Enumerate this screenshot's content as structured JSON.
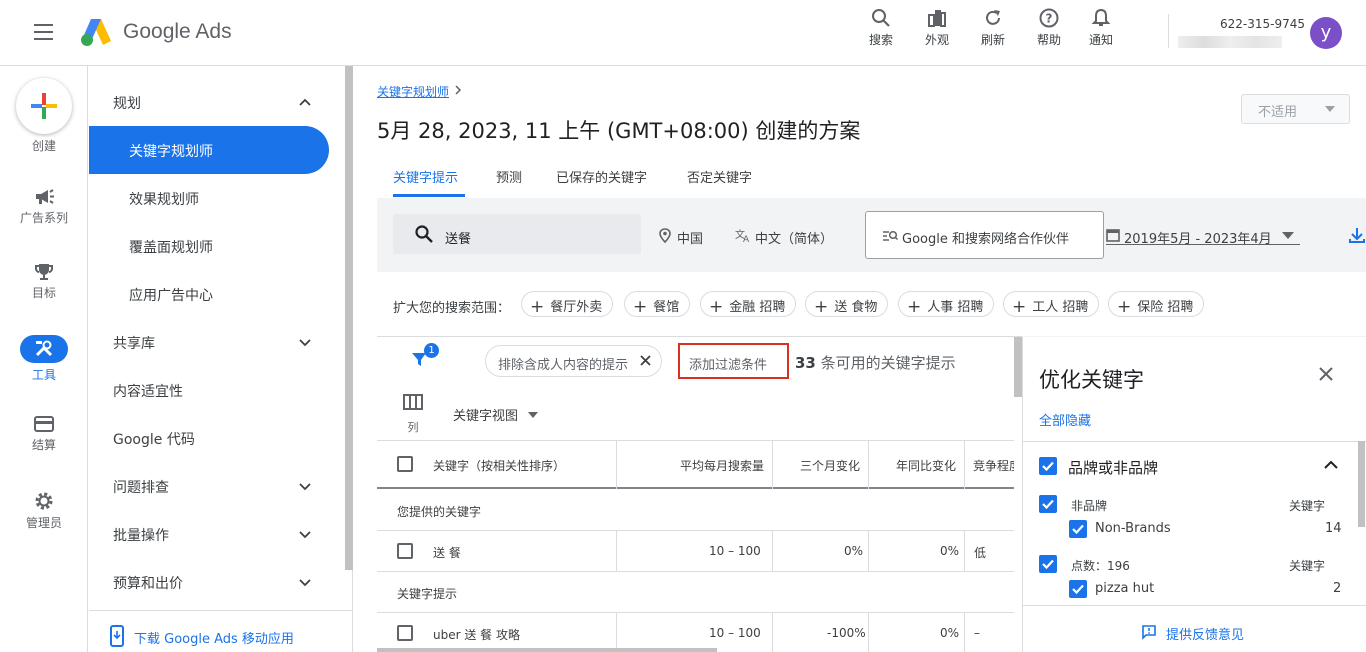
{
  "header": {
    "app_name": "Google Ads",
    "tools": [
      {
        "label": "搜索",
        "icon": "search-icon"
      },
      {
        "label": "外观",
        "icon": "appearance-icon"
      },
      {
        "label": "刷新",
        "icon": "refresh-icon"
      },
      {
        "label": "帮助",
        "icon": "help-icon"
      },
      {
        "label": "通知",
        "icon": "bell-icon"
      }
    ],
    "account_id": "622-315-9745",
    "avatar_letter": "y"
  },
  "rail": {
    "items": [
      {
        "label": "创建",
        "icon": "plus-icon"
      },
      {
        "label": "广告系列",
        "icon": "megaphone-icon"
      },
      {
        "label": "目标",
        "icon": "trophy-icon"
      },
      {
        "label": "工具",
        "icon": "tools-icon",
        "active": true
      },
      {
        "label": "结算",
        "icon": "credit-card-icon"
      },
      {
        "label": "管理员",
        "icon": "gear-icon"
      }
    ]
  },
  "nav": {
    "planning_header": "规划",
    "planning_items": [
      "关键字规划师",
      "效果规划师",
      "覆盖面规划师",
      "应用广告中心"
    ],
    "sections": [
      "共享库",
      "内容适宜性",
      "Google 代码",
      "问题排查",
      "批量操作",
      "预算和出价"
    ],
    "download_app": "下载 Google Ads 移动应用"
  },
  "main": {
    "breadcrumb": "关键字规划师",
    "title": "5月 28, 2023, 11 上午 (GMT+08:00) 创建的方案",
    "na_select": "不适用",
    "tabs": [
      "关键字提示",
      "预测",
      "已保存的关键字",
      "否定关键字"
    ],
    "search_value": "送餐",
    "location": "中国",
    "language": "中文（简体）",
    "network": "Google 和搜索网络合作伙伴",
    "date_range": "2019年5月 - 2023年4月",
    "expand_label": "扩大您的搜索范围：",
    "expand_chips": [
      "餐厅外卖",
      "餐馆",
      "金融 招聘",
      "送 食物",
      "人事 招聘",
      "工人 招聘",
      "保险 招聘"
    ],
    "filter_badge": "1",
    "exclude_chip": "排除含成人内容的提示",
    "add_filter": "添加过滤条件",
    "available_count": "33",
    "available_text": "条可用的关键字提示",
    "columns_label": "列",
    "keyword_view": "关键字视图",
    "table": {
      "headers": [
        "关键字（按相关性排序）",
        "平均每月搜索量",
        "三个月变化",
        "年同比变化",
        "竞争程度"
      ],
      "group1": "您提供的关键字",
      "row1": [
        "送 餐",
        "10 – 100",
        "0%",
        "0%",
        "低"
      ],
      "group2": "关键字提示",
      "row2": [
        "uber 送 餐 攻略",
        "10 – 100",
        "-100%",
        "0%",
        "–"
      ]
    }
  },
  "refine_panel": {
    "title": "优化关键字",
    "hide_all": "全部隐藏",
    "group": "品牌或非品牌",
    "sub1_label": "非品牌",
    "sub1_col": "关键字",
    "sub1_item": "Non-Brands",
    "sub1_count": "14",
    "sub2_label": "点数：196",
    "sub2_col": "关键字",
    "sub2_item": "pizza hut",
    "sub2_count": "2",
    "feedback": "提供反馈意见"
  },
  "colors": {
    "accent": "#1a73e8",
    "highlight_border": "#d93025"
  }
}
